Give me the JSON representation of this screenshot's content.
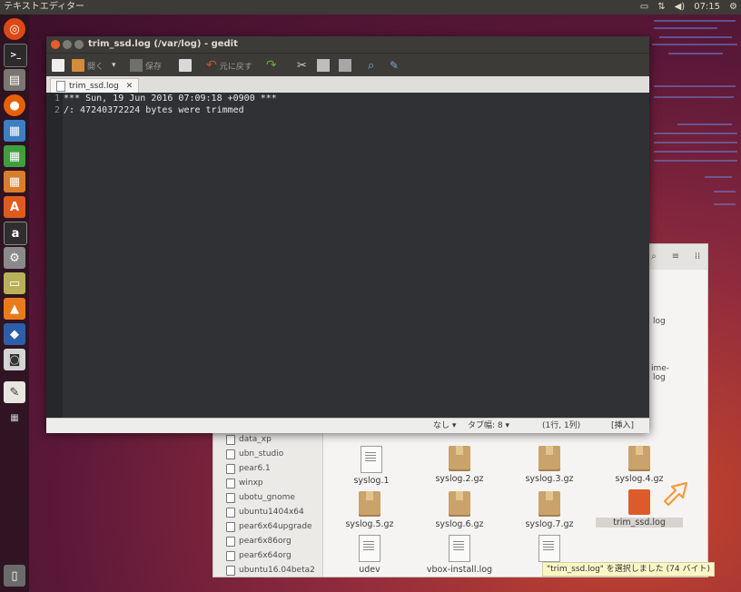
{
  "top_panel": {
    "app_title": "テキストエディター",
    "volume_icon": "volume-icon",
    "time": "07:15"
  },
  "gedit": {
    "window_title": "trim_ssd.log (/var/log) - gedit",
    "toolbar": {
      "open_label": "開く",
      "save_label": "保存",
      "undo_label": "元に戻す"
    },
    "tab_label": "trim_ssd.log",
    "lines": [
      {
        "num": "1",
        "text": "*** Sun, 19 Jun 2016 07:09:18 +0900 ***"
      },
      {
        "num": "2",
        "text": "/: 47240372224 bytes were trimmed"
      }
    ],
    "status": {
      "syntax": "なし",
      "tab_width": "タブ幅: 8",
      "position": "(1行, 1列)",
      "mode": "[挿入]"
    }
  },
  "nautilus": {
    "sidebar_items": [
      {
        "label": "data_xp"
      },
      {
        "label": "ubn_studio"
      },
      {
        "label": "pear6.1"
      },
      {
        "label": "winxp"
      },
      {
        "label": "ubotu_gnome"
      },
      {
        "label": "ubuntu1404x64"
      },
      {
        "label": "pear6x64upgrade"
      },
      {
        "label": "pear6x86org"
      },
      {
        "label": "pear6x64org"
      },
      {
        "label": "ubuntu16.04beta2"
      }
    ],
    "files": [
      {
        "name": "syslog.1",
        "kind": "text"
      },
      {
        "name": "syslog.2.gz",
        "kind": "archive"
      },
      {
        "name": "syslog.3.gz",
        "kind": "archive"
      },
      {
        "name": "syslog.4.gz",
        "kind": "archive"
      },
      {
        "name": "syslog.5.gz",
        "kind": "archive"
      },
      {
        "name": "syslog.6.gz",
        "kind": "archive"
      },
      {
        "name": "syslog.7.gz",
        "kind": "archive"
      },
      {
        "name": "trim_ssd.log",
        "kind": "selected"
      },
      {
        "name": "udev",
        "kind": "text"
      },
      {
        "name": "vbox-install.log",
        "kind": "text"
      },
      {
        "name": "",
        "kind": "text"
      }
    ],
    "partial_labels": [
      "log",
      "log",
      "ime-",
      "log",
      "log"
    ],
    "status_message": "\"trim_ssd.log\" を選択しました (74 バイト)"
  }
}
